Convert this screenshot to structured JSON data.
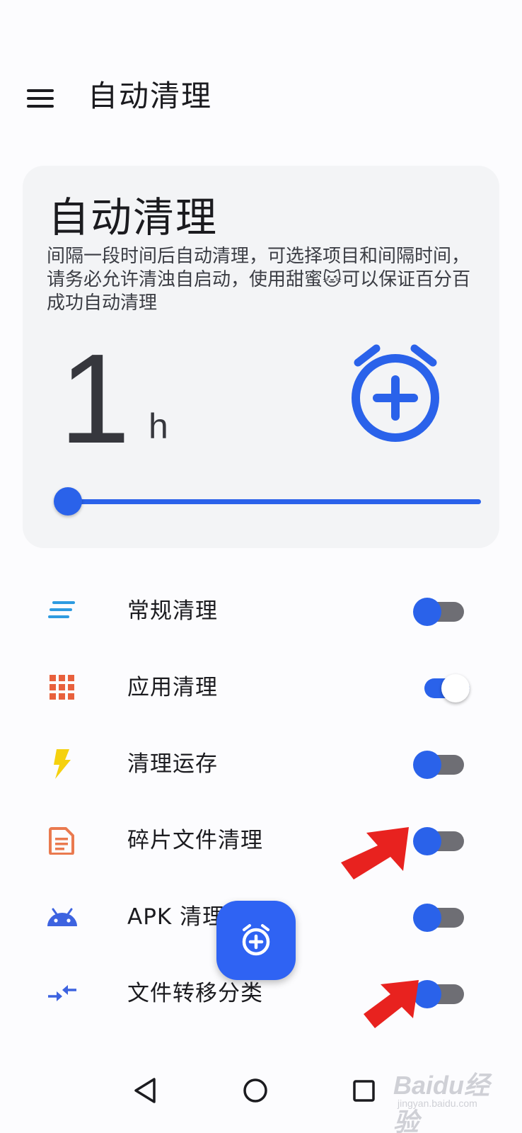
{
  "header": {
    "title": "自动清理"
  },
  "card": {
    "title": "自动清理",
    "description": "间隔一段时间后自动清理，可选择项目和间隔时间，请务必允许清浊自启动，使用甜蜜🐱可以保证百分百成功自动清理",
    "interval_value": "1",
    "interval_unit": "h",
    "slider_value_fraction": 0
  },
  "options": [
    {
      "label": "常规清理",
      "icon": "lines-icon",
      "enabled": false,
      "icon_color": "#2e9be0"
    },
    {
      "label": "应用清理",
      "icon": "grid-icon",
      "enabled": true,
      "icon_color": "#e8603c"
    },
    {
      "label": "清理运存",
      "icon": "lightning-icon",
      "enabled": false,
      "icon_color": "#f5d10f"
    },
    {
      "label": "碎片文件清理",
      "icon": "document-icon",
      "enabled": false,
      "icon_color": "#ea7a4f"
    },
    {
      "label": "APK 清理",
      "icon": "android-icon",
      "enabled": false,
      "icon_color": "#3d63e0"
    },
    {
      "label": "文件转移分类",
      "icon": "transfer-arrows-icon",
      "enabled": false,
      "icon_color": "#3d63e0"
    }
  ],
  "fab": {
    "icon": "alarm-add-icon"
  },
  "watermark": {
    "brand": "Baidu经验",
    "site": "jingyan.baidu.com"
  },
  "colors": {
    "accent": "#2a62ea",
    "switch_off_track": "#6e6e74",
    "annotation_arrow": "#e8221f"
  }
}
